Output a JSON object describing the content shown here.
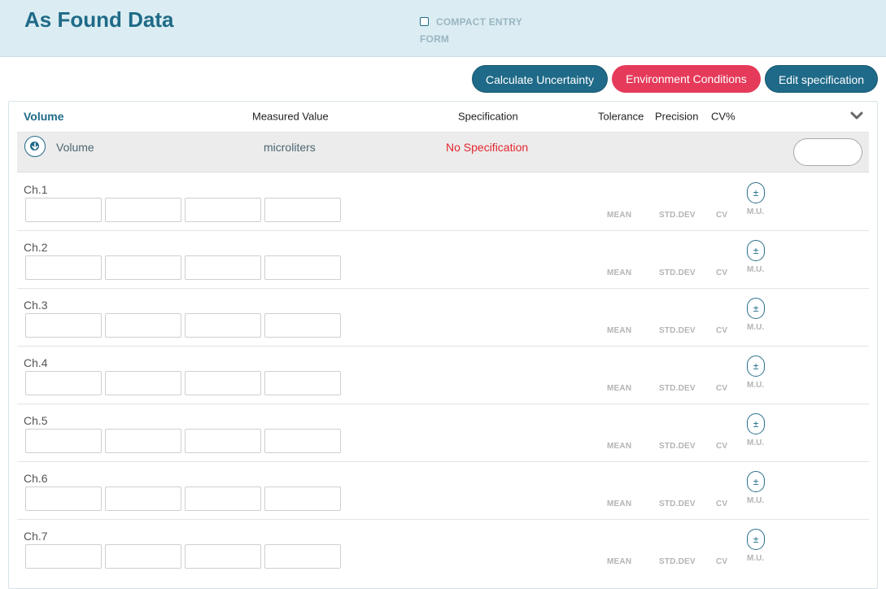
{
  "header": {
    "title": "As Found Data",
    "compact_entry_line1": "COMPACT ENTRY",
    "compact_entry_line2": "FORM",
    "compact_entry_checked": false
  },
  "actions": {
    "calculate_uncertainty": "Calculate Uncertainty",
    "environment_conditions": "Environment Conditions",
    "edit_specification": "Edit specification"
  },
  "table": {
    "columns": {
      "section": "Volume",
      "measured_value": "Measured Value",
      "specification": "Specification",
      "tolerance": "Tolerance",
      "precision": "Precision",
      "cv": "CV%"
    },
    "volume_row": {
      "label": "Volume",
      "unit": "microliters",
      "specification": "No Specification"
    }
  },
  "stat_labels": {
    "mean": "MEAN",
    "std_dev": "STD.DEV",
    "cv": "CV",
    "mu_symbol": "±",
    "mu": "M.U."
  },
  "channels": [
    {
      "label": "Ch.1",
      "readings": [
        "",
        "",
        "",
        ""
      ]
    },
    {
      "label": "Ch.2",
      "readings": [
        "",
        "",
        "",
        ""
      ]
    },
    {
      "label": "Ch.3",
      "readings": [
        "",
        "",
        "",
        ""
      ]
    },
    {
      "label": "Ch.4",
      "readings": [
        "",
        "",
        "",
        ""
      ]
    },
    {
      "label": "Ch.5",
      "readings": [
        "",
        "",
        "",
        ""
      ]
    },
    {
      "label": "Ch.6",
      "readings": [
        "",
        "",
        "",
        ""
      ]
    },
    {
      "label": "Ch.7",
      "readings": [
        "",
        "",
        "",
        ""
      ]
    }
  ],
  "colors": {
    "primary": "#1f6a88",
    "accent": "#e63a5a",
    "header_bg": "#dbedf2",
    "error_text": "#e3262e"
  }
}
